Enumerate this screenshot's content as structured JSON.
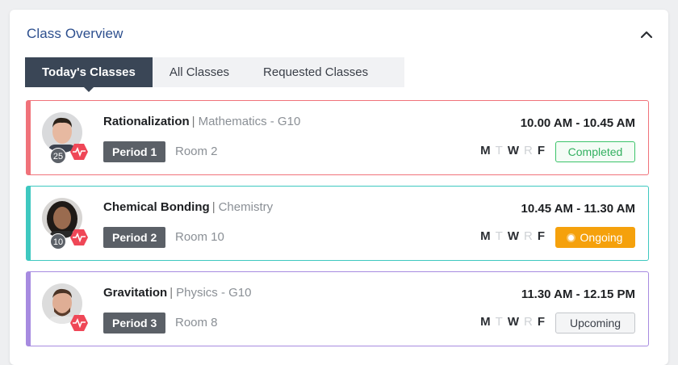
{
  "panel": {
    "title": "Class Overview",
    "collapse_icon": "chevron-up-icon"
  },
  "tabs": [
    {
      "label": "Today's Classes",
      "active": true
    },
    {
      "label": "All Classes",
      "active": false
    },
    {
      "label": "Requested Classes",
      "active": false
    }
  ],
  "classes": [
    {
      "topic": "Rationalization",
      "subject": "Mathematics - G10",
      "period": "Period 1",
      "room": "Room 2",
      "time": "10.00 AM - 10.45 AM",
      "days": [
        "M",
        "T",
        "W",
        "R",
        "F"
      ],
      "status": "Completed",
      "count": "25",
      "accent": "#f0727a"
    },
    {
      "topic": "Chemical Bonding",
      "subject": "Chemistry",
      "period": "Period 2",
      "room": "Room 10",
      "time": "10.45 AM - 11.30 AM",
      "days": [
        "M",
        "T",
        "W",
        "R",
        "F"
      ],
      "status": "Ongoing",
      "count": "10",
      "accent": "#3ec8c0"
    },
    {
      "topic": "Gravitation",
      "subject": "Physics - G10",
      "period": "Period 3",
      "room": "Room 8",
      "time": "11.30 AM - 12.15 PM",
      "days": [
        "M",
        "T",
        "W",
        "R",
        "F"
      ],
      "status": "Upcoming",
      "count": "",
      "accent": "#a78be0"
    }
  ],
  "colors": {
    "title": "#2d4f8e",
    "active_tab": "#3a4656",
    "completed": "#33b060",
    "ongoing": "#f5a10c",
    "pulse_badge": "#ef4757"
  }
}
